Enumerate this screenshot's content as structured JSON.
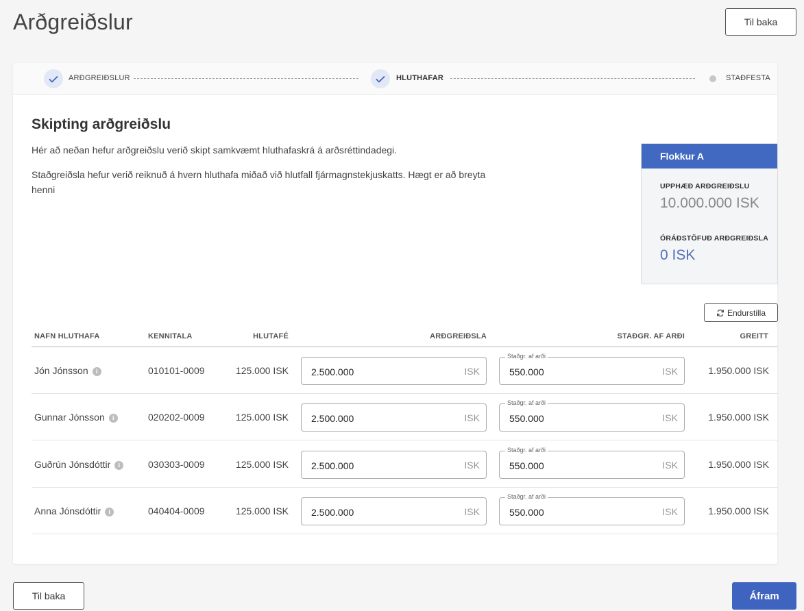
{
  "page": {
    "title": "Arðgreiðslur",
    "back_label": "Til baka",
    "next_label": "Áfram"
  },
  "stepper": {
    "steps": [
      {
        "label": "ARÐGREIÐSLUR",
        "state": "done"
      },
      {
        "label": "HLUTHAFAR",
        "state": "current"
      },
      {
        "label": "STAÐFESTA",
        "state": "pending"
      }
    ]
  },
  "section": {
    "title": "Skipting arðgreiðslu",
    "desc1": "Hér að neðan hefur arðgreiðslu verið skipt samkvæmt hluthafaskrá á arðsréttindadegi.",
    "desc2_line1": "Staðgreiðsla hefur verið reiknuð á hvern hluthafa miðað við hlutfall fjármagnstekjuskatts. Hægt er að breyta",
    "desc2_line2": "henni"
  },
  "summary": {
    "title": "Flokkur A",
    "amount_label": "UPPHÆÐ ARÐGREIÐSLU",
    "amount_value": "10.000.000 ISK",
    "unallocated_label": "ÓRÁÐSTÖFUÐ ARÐGREIÐSLA",
    "unallocated_value": "0 ISK"
  },
  "reset_label": "Endurstilla",
  "table": {
    "headers": {
      "name": "NAFN HLUTHAFA",
      "kennitala": "KENNITALA",
      "hlutafe": "HLUTAFÉ",
      "ardgreidsla": "ARÐGREIÐSLA",
      "stadgr": "STAÐGR. AF ARÐI",
      "greitt": "GREITT"
    },
    "input_unit": "ISK",
    "stadgr_float_label": "Staðgr. af arði",
    "rows": [
      {
        "name": "Jón Jónsson",
        "kennitala": "010101-0009",
        "hlutafe": "125.000 ISK",
        "ardgreidsla": "2.500.000",
        "stadgr": "550.000",
        "greitt": "1.950.000 ISK"
      },
      {
        "name": "Gunnar Jónsson",
        "kennitala": "020202-0009",
        "hlutafe": "125.000 ISK",
        "ardgreidsla": "2.500.000",
        "stadgr": "550.000",
        "greitt": "1.950.000 ISK"
      },
      {
        "name": "Guðrún Jónsdóttir",
        "kennitala": "030303-0009",
        "hlutafe": "125.000 ISK",
        "ardgreidsla": "2.500.000",
        "stadgr": "550.000",
        "greitt": "1.950.000 ISK"
      },
      {
        "name": "Anna Jónsdóttir",
        "kennitala": "040404-0009",
        "hlutafe": "125.000 ISK",
        "ardgreidsla": "2.500.000",
        "stadgr": "550.000",
        "greitt": "1.950.000 ISK"
      }
    ]
  },
  "colors": {
    "primary": "#3f64c0",
    "summary_header": "#4269c1",
    "step_done_bg": "#e3e8f6"
  },
  "icons": {
    "step_done": "checkmark-icon",
    "info": "info-icon",
    "reset": "refresh-icon"
  }
}
